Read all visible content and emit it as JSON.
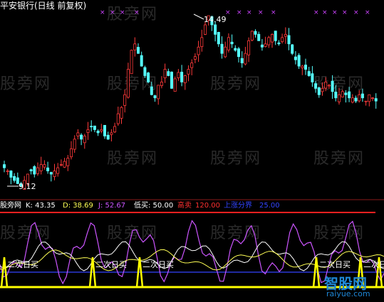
{
  "main_panel": {
    "title": "平安银行(日线 前复权)",
    "high_label": "14.49",
    "low_label": "9.12"
  },
  "indicator_panel": {
    "labels": [
      {
        "text": "股旁网",
        "color": "#ffffff"
      },
      {
        "text": "K: 43.35",
        "color": "#ffffff"
      },
      {
        "text": "D: 38.69",
        "color": "#ffff55"
      },
      {
        "text": "J: 52.67",
        "color": "#cc55ff"
      },
      {
        "text": "低买: 50.00",
        "color": "#ffffff"
      },
      {
        "text": "高卖",
        "color": "#ff3030"
      },
      {
        "text": "120.00",
        "color": "#ff3030"
      },
      {
        "text": "上涨分界",
        "color": "#3344ff"
      },
      {
        "text": "25.00",
        "color": "#3344ff"
      }
    ],
    "signal_label": "二次日买",
    "signal_count": 6
  },
  "watermark": "股旁网",
  "brand": {
    "name": "智股网",
    "url": "raiyue.com"
  },
  "colors": {
    "up": "#ff3a3a",
    "down": "#55ffff",
    "k": "#ffffff",
    "d": "#ffff55",
    "j": "#cc55ff",
    "high_line": "#ff2020",
    "mid_line": "#3344ff",
    "signal": "#ffff00",
    "cross_marker": "#cc44ff"
  },
  "chart_data": [
    {
      "type": "candlestick",
      "title": "平安银行(日线 前复权)",
      "series": [
        {
          "name": "",
          "values": [
            9.7,
            9.6,
            9.4,
            9.3,
            9.2,
            9.12,
            9.3,
            9.5,
            9.6,
            9.5,
            9.7,
            9.8,
            9.8,
            9.6,
            9.5,
            9.6,
            9.7,
            9.8,
            9.9,
            10.0,
            10.3,
            10.6,
            10.8,
            10.6,
            10.7,
            10.9,
            11.0,
            10.9,
            10.8,
            10.9,
            10.7,
            10.6,
            10.8,
            11.0,
            11.4,
            11.6,
            12.0,
            12.8,
            13.4,
            13.6,
            13.3,
            12.9,
            12.6,
            12.4,
            12.0,
            11.9,
            12.3,
            12.4,
            12.8,
            12.6,
            12.2,
            12.5,
            12.7,
            12.4,
            12.6,
            12.8,
            13.0,
            13.2,
            13.5,
            13.8,
            14.2,
            14.49,
            14.2,
            13.9,
            13.6,
            13.3,
            13.5,
            13.8,
            13.6,
            13.4,
            13.2,
            13.0,
            13.3,
            13.7,
            14.0,
            13.9,
            13.7,
            13.5,
            13.6,
            13.8,
            13.9,
            13.7,
            13.6,
            13.8,
            13.9,
            13.6,
            13.3,
            13.1,
            12.9,
            12.9,
            12.8,
            12.6,
            12.4,
            12.2,
            12.0,
            12.2,
            12.4,
            12.3,
            12.1,
            11.9,
            12.0,
            12.1,
            12.0,
            11.9,
            11.9,
            11.8,
            12.0,
            11.9,
            11.8,
            12.0,
            11.9,
            11.8
          ]
        }
      ],
      "low": 9.12,
      "high": 14.49
    },
    {
      "type": "line",
      "series": [
        {
          "name": "K",
          "values": [
            43.35
          ]
        },
        {
          "name": "D",
          "values": [
            38.69
          ]
        },
        {
          "name": "J",
          "values": [
            52.67
          ]
        }
      ],
      "reference_lines": [
        {
          "name": "低买",
          "value": 50.0
        },
        {
          "name": "高卖",
          "value": 120.0
        },
        {
          "name": "上涨分界",
          "value": 25.0
        }
      ]
    }
  ]
}
